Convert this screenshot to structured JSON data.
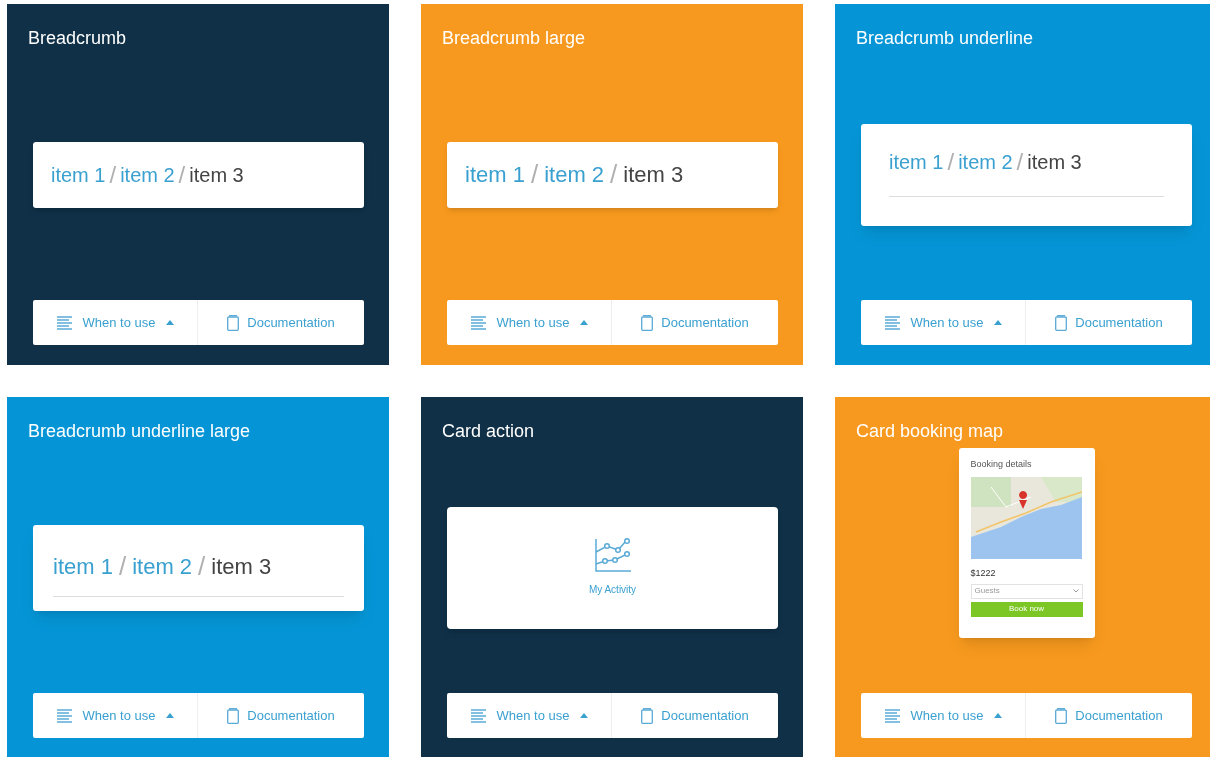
{
  "tiles": [
    {
      "title": "Breadcrumb",
      "color": "#0f3047",
      "preview": {
        "kind": "breadcrumb",
        "large": false,
        "separator": "/",
        "items": [
          {
            "label": "item 1",
            "current": false
          },
          {
            "label": "item 2",
            "current": false
          },
          {
            "label": "item 3",
            "current": true
          }
        ]
      },
      "footer": {
        "when": "When to use",
        "docs": "Documentation"
      }
    },
    {
      "title": "Breadcrumb large",
      "color": "#f7991e",
      "preview": {
        "kind": "breadcrumb",
        "large": true,
        "separator": "/",
        "items": [
          {
            "label": "item 1",
            "current": false
          },
          {
            "label": "item 2",
            "current": false
          },
          {
            "label": "item 3",
            "current": true
          }
        ]
      },
      "footer": {
        "when": "When to use",
        "docs": "Documentation"
      }
    },
    {
      "title": "Breadcrumb underline",
      "color": "#0595d6",
      "preview": {
        "kind": "breadcrumb_underline",
        "large": false,
        "separator": "/",
        "items": [
          {
            "label": "item 1",
            "current": false
          },
          {
            "label": "item 2",
            "current": false
          },
          {
            "label": "item 3",
            "current": true
          }
        ]
      },
      "footer": {
        "when": "When to use",
        "docs": "Documentation"
      }
    },
    {
      "title": "Breadcrumb underline large",
      "color": "#0595d6",
      "preview": {
        "kind": "breadcrumb_underline",
        "large": true,
        "separator": "/",
        "items": [
          {
            "label": "item 1",
            "current": false
          },
          {
            "label": "item 2",
            "current": false
          },
          {
            "label": "item 3",
            "current": true
          }
        ]
      },
      "footer": {
        "when": "When to use",
        "docs": "Documentation"
      }
    },
    {
      "title": "Card action",
      "color": "#0f3047",
      "preview": {
        "kind": "card_action",
        "label": "My Activity"
      },
      "footer": {
        "when": "When to use",
        "docs": "Documentation"
      }
    },
    {
      "title": "Card booking map",
      "color": "#f7991e",
      "preview": {
        "kind": "card_booking",
        "heading": "Booking details",
        "price": "$1222",
        "select": "Guests",
        "button": "Book now"
      },
      "footer": {
        "when": "When to use",
        "docs": "Documentation"
      }
    }
  ]
}
